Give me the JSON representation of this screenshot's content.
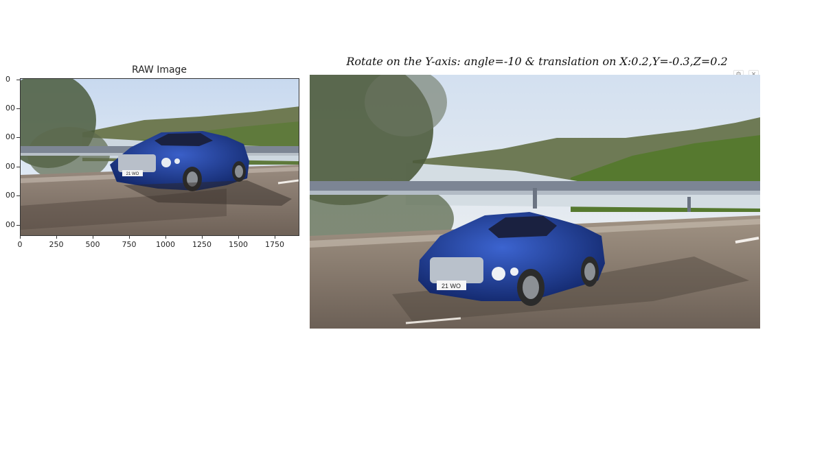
{
  "left_panel": {
    "title": "RAW Image",
    "y_ticks": [
      "0",
      "00",
      "00",
      "00",
      "00",
      "00"
    ],
    "x_ticks": [
      "0",
      "250",
      "500",
      "750",
      "1000",
      "1250",
      "1500",
      "1750"
    ]
  },
  "right_panel": {
    "title": "Rotate on the Y-axis: angle=-10 & translation on X:0.2,Y=-0.3,Z=0.2",
    "plate": "21 WO"
  },
  "raw_plate": "21 WO",
  "colors": {
    "car_blue": "#1d3a8f",
    "sky": "#dfe9f5",
    "road": "#8a7d70"
  },
  "icons": {
    "settings": "gear-icon",
    "close": "close-icon"
  }
}
